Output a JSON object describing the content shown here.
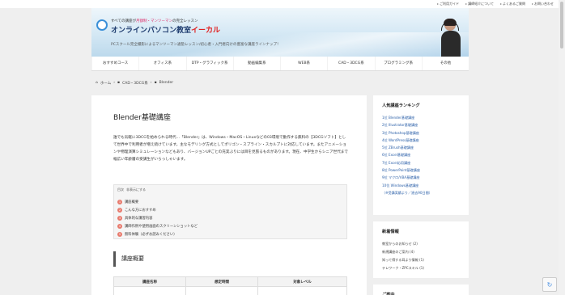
{
  "topbar": {
    "links": [
      "ご利用ガイド",
      "講師紹介について",
      "よくあるご質問",
      "お問い合わせ"
    ]
  },
  "header": {
    "tagline_pre": "すべての講座が",
    "tagline_hl": "月額制・マンツーマン",
    "tagline_post": "の完全レッスン",
    "sitename_main": "オンラインパソコン教室",
    "sitename_red": "イーカル",
    "subline": "PCスクール完全撮影によるマンツーマン通塾レッスン/初心者・入門者向けの豊富な講座ラインナップ！"
  },
  "nav": [
    "おすすめコース",
    "オフィス系",
    "DTP・グラフィック系",
    "動画編集系",
    "WEB系",
    "CAD・3DCG系",
    "プログラミング系",
    "その他"
  ],
  "breadcrumb": {
    "home": "ホーム",
    "cat": "CAD・3DCG系",
    "page": "Blender"
  },
  "article": {
    "title": "Blender基礎講座",
    "intro": "誰でも気軽に3DCGを始められる時代…「Blender」は、Windows・MacOS・Linuxなどの03環境で動作する無料の【3DCGソフト】として世界中で利用者が増え続けています。主なモデリング方式としてポリゴン・スプライン・スカルプトに対応しています。またアニメーションや物理演算シミュレーションなどもあり、バージョンUPごとの充実ぶりには目を見張るものがあります。現在、中学生からシニア世代まで幅広い年齢層の受講生がいらっしゃいます。",
    "toc_label": "目次",
    "toc_toggle": "非表示にする",
    "toc": [
      "講座概要",
      "こんな方におすすめ",
      "具体的な講習内容",
      "講師作例や使用画面のスクリーンショットなど",
      "無料体験（必ずお読みください）"
    ],
    "section_title": "講座概要",
    "table_headers": [
      "講座名称",
      "想定時間",
      "対象レベル"
    ]
  },
  "sidebar": {
    "ranking_title": "人気講座ランキング",
    "ranking": [
      "1位 Blender基礎講座",
      "2位 Illustrator基礎講座",
      "3位 Photoshop基礎講座",
      "4位 WordPress基礎講座",
      "5位 ZBrush基礎講座",
      "6位 Excel基礎講座",
      "7位 Excel応用講座",
      "8位 PowerPoint基礎講座",
      "9位 マクロ/VBA基礎講座",
      "10位 Windows基礎講座"
    ],
    "ranking_note": "（※受講実績より／過去90日間）",
    "news_title": "新着情報",
    "news": [
      "教室からのお知らせ (2)",
      "新規講座のご案内 (4)",
      "知って得する耳より情報 (1)",
      "テレワーク・ZPCスキル (1)"
    ],
    "third_title": "ご案内"
  }
}
